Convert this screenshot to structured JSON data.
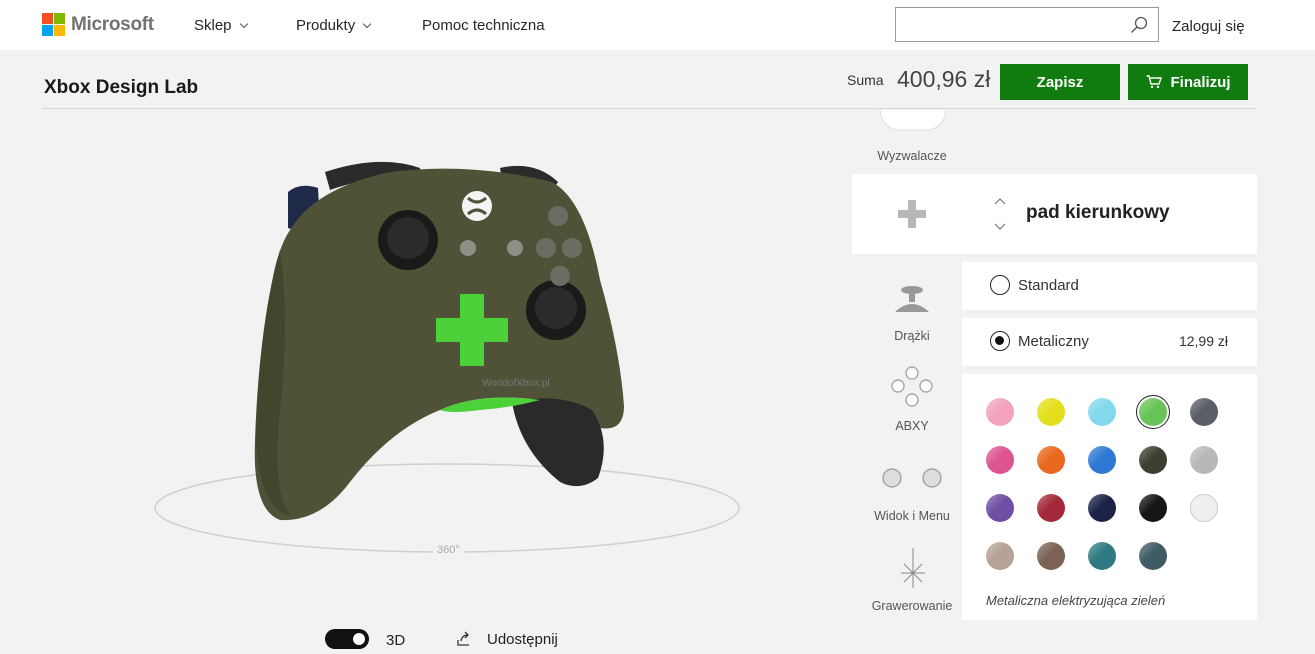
{
  "nav": {
    "brand": "Microsoft",
    "items": [
      {
        "label": "Sklep",
        "has_dropdown": true
      },
      {
        "label": "Produkty",
        "has_dropdown": true
      },
      {
        "label": "Pomoc techniczna",
        "has_dropdown": false
      }
    ],
    "search_placeholder": "",
    "signin": "Zaloguj się"
  },
  "header": {
    "title": "Xbox Design Lab",
    "sum_label": "Suma",
    "sum_value": "400,96 zł",
    "save_label": "Zapisz",
    "finalize_label": "Finalizuj"
  },
  "preview": {
    "rotate_label": "360°",
    "controller_body_color": "#4f5236",
    "dpad_color": "#4cd13a",
    "watermark": "WorldofXbox.pl"
  },
  "bottom": {
    "mode_label": "3D",
    "mode_3d_on": true,
    "share_label": "Udostępnij"
  },
  "parts": {
    "above": {
      "label": "Wyzwalacze"
    },
    "items": [
      {
        "label": "Drążki",
        "icon": "thumbstick-icon"
      },
      {
        "label": "ABXY",
        "icon": "abxy-icon"
      },
      {
        "label": "Widok i Menu",
        "icon": "view-menu-icon"
      },
      {
        "label": "Grawerowanie",
        "icon": "engraving-icon"
      }
    ]
  },
  "section": {
    "title": "pad kierunkowy",
    "options": [
      {
        "label": "Standard",
        "price": "",
        "selected": false
      },
      {
        "label": "Metaliczny",
        "price": "12,99 zł",
        "selected": true
      }
    ]
  },
  "swatches": {
    "colors": [
      "#f2a2bc",
      "#e4df1e",
      "#84d8ee",
      "#68c456",
      "#5a5e66",
      "#dd5590",
      "#e8691f",
      "#2f79d4",
      "#3d3d30",
      "#b8b8b8",
      "#6f4ea3",
      "#a52838",
      "#1c2346",
      "#151515",
      "#eeeeee",
      "#b6a296",
      "#7b6255",
      "#2f7a82",
      "#3f5b66"
    ],
    "selected_index": 3,
    "selected_name": "Metaliczna elektryzująca zieleń"
  },
  "colors": {
    "accent_green": "#107c10"
  }
}
